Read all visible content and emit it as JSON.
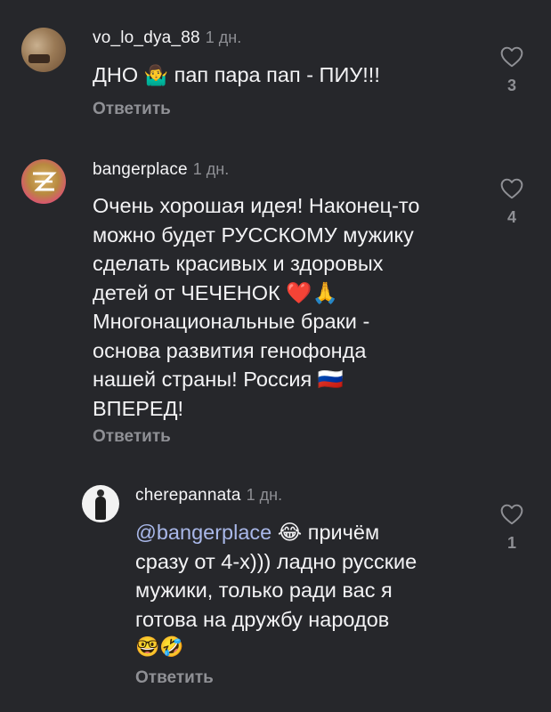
{
  "comments": [
    {
      "username": "vo_lo_dya_88",
      "time": "1 дн.",
      "text_before": "ДНО ",
      "emoji": "🤷‍♂️",
      "text_after": " пап пара пап - ПИУ!!!",
      "reply_label": "Ответить",
      "likes": "3"
    },
    {
      "username": "bangerplace",
      "time": "1 дн.",
      "lines": [
        "Очень хорошая идея! Наконец-то",
        "можно будет РУССКОМУ мужику",
        "сделать красивых и здоровых",
        "детей от ЧЕЧЕНОК ❤️🙏",
        "Многонациональные браки -",
        "основа развития генофонда",
        "нашей страны! Россия 🇷🇺",
        "ВПЕРЕД!"
      ],
      "reply_label": "Ответить",
      "likes": "4"
    },
    {
      "username": "cherepannata",
      "time": "1 дн.",
      "mention": "@bangerplace",
      "line1_rest": " 😂 причём",
      "lines": [
        "сразу от 4-х))) ладно русские",
        "мужики, только ради вас я",
        "готова на дружбу народов",
        "🤓🤣"
      ],
      "reply_label": "Ответить",
      "likes": "1"
    }
  ],
  "colors": {
    "background": "#26272b",
    "text": "#f3f3f5",
    "muted": "#8f9095",
    "mention": "#a9b8e9"
  },
  "icons": [
    "heart-outline-icon"
  ]
}
